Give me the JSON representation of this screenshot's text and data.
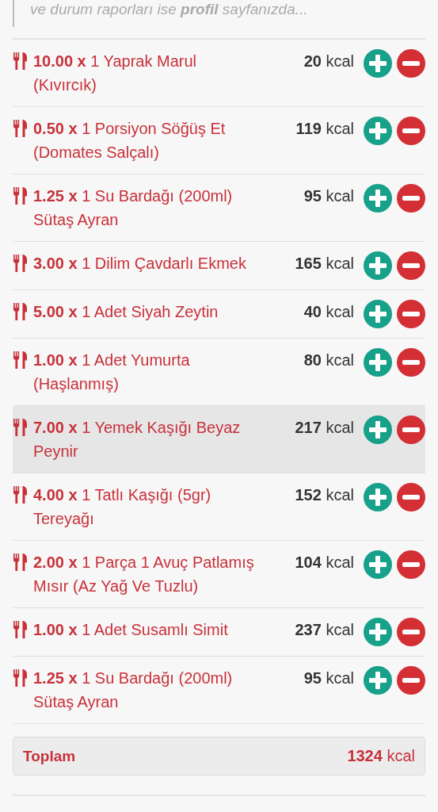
{
  "note": {
    "text": "ve durum raporları ise **profil** sayfanızda..."
  },
  "items": [
    {
      "text": "**10.00 x** 1 Yaprak Marul (Kıvırcık)",
      "kcal": "**20** kcal",
      "selected": false
    },
    {
      "text": "**0.50 x** 1 Porsiyon Söğüş Et (Domates Salçalı)",
      "kcal": "**119** kcal",
      "selected": false
    },
    {
      "text": "**1.25 x** 1 Su Bardağı (200ml) Sütaş Ayran",
      "kcal": "**95** kcal",
      "selected": false
    },
    {
      "text": "**3.00 x** 1 Dilim Çavdarlı Ekmek",
      "kcal": "**165** kcal",
      "selected": false
    },
    {
      "text": "**5.00 x** 1 Adet Siyah Zeytin",
      "kcal": "**40** kcal",
      "selected": false
    },
    {
      "text": "**1.00 x** 1 Adet Yumurta (Haşlanmış)",
      "kcal": "**80** kcal",
      "selected": false
    },
    {
      "text": "**7.00 x** 1 Yemek Kaşığı Beyaz Peynir",
      "kcal": "**217** kcal",
      "selected": true
    },
    {
      "text": "**4.00 x** 1 Tatlı Kaşığı (5gr) Tereyağı",
      "kcal": "**152** kcal",
      "selected": false
    },
    {
      "text": "**2.00 x** 1 Parça 1 Avuç Patlamış Mısır (Az Yağ Ve Tuzlu)",
      "kcal": "**104** kcal",
      "selected": false
    },
    {
      "text": "**1.00 x** 1 Adet Susamlı Simit",
      "kcal": "**237** kcal",
      "selected": false
    },
    {
      "text": "**1.25 x** 1 Su Bardağı (200ml) Sütaş Ayran",
      "kcal": "**95** kcal",
      "selected": false
    }
  ],
  "total": {
    "label": "Toplam",
    "value": "**1324** kcal"
  }
}
